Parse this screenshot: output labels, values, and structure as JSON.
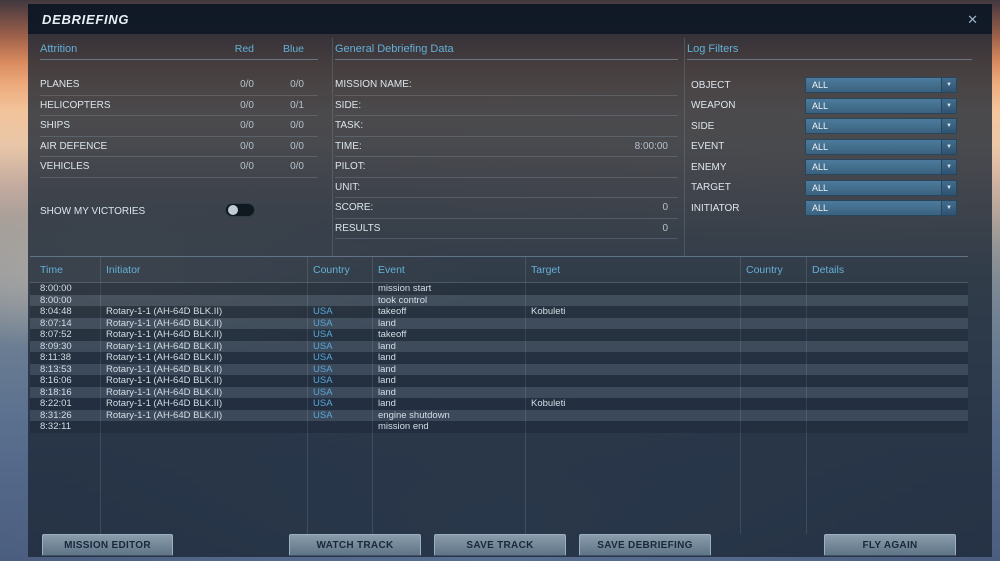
{
  "title_bar": {
    "title": "DEBRIEFING",
    "close": "✕"
  },
  "attrition": {
    "header": "Attrition",
    "col_red": "Red",
    "col_blue": "Blue",
    "rows": [
      {
        "label": "PLANES",
        "red": "0/0",
        "blue": "0/0"
      },
      {
        "label": "HELICOPTERS",
        "red": "0/0",
        "blue": "0/1"
      },
      {
        "label": "SHIPS",
        "red": "0/0",
        "blue": "0/0"
      },
      {
        "label": "AIR DEFENCE",
        "red": "0/0",
        "blue": "0/0"
      },
      {
        "label": "VEHICLES",
        "red": "0/0",
        "blue": "0/0"
      }
    ],
    "show_victories_label": "SHOW MY VICTORIES",
    "show_victories_state": "off"
  },
  "general": {
    "header": "General Debriefing Data",
    "rows": [
      {
        "label": "MISSION NAME:",
        "value": ""
      },
      {
        "label": "SIDE:",
        "value": ""
      },
      {
        "label": "TASK:",
        "value": ""
      },
      {
        "label": "TIME:",
        "value": "8:00:00"
      },
      {
        "label": "PILOT:",
        "value": ""
      },
      {
        "label": "UNIT:",
        "value": ""
      },
      {
        "label": "SCORE:",
        "value": "0"
      },
      {
        "label": "RESULTS",
        "value": "0"
      }
    ]
  },
  "log_filters": {
    "header": "Log Filters",
    "filters": [
      {
        "label": "OBJECT",
        "value": "ALL"
      },
      {
        "label": "WEAPON",
        "value": "ALL"
      },
      {
        "label": "SIDE",
        "value": "ALL"
      },
      {
        "label": "EVENT",
        "value": "ALL"
      },
      {
        "label": "ENEMY",
        "value": "ALL"
      },
      {
        "label": "TARGET",
        "value": "ALL"
      },
      {
        "label": "INITIATOR",
        "value": "ALL"
      }
    ]
  },
  "log_table": {
    "columns": [
      "Time",
      "Initiator",
      "Country",
      "Event",
      "Target",
      "Country",
      "Details"
    ],
    "rows": [
      [
        "8:00:00",
        "",
        "",
        "mission start",
        "",
        "",
        ""
      ],
      [
        "8:00:00",
        "",
        "",
        "took control",
        "",
        "",
        ""
      ],
      [
        "8:04:48",
        "Rotary-1-1 (AH-64D BLK.II)",
        "USA",
        "takeoff",
        "Kobuleti",
        "",
        ""
      ],
      [
        "8:07:14",
        "Rotary-1-1 (AH-64D BLK.II)",
        "USA",
        "land",
        "",
        "",
        ""
      ],
      [
        "8:07:52",
        "Rotary-1-1 (AH-64D BLK.II)",
        "USA",
        "takeoff",
        "",
        "",
        ""
      ],
      [
        "8:09:30",
        "Rotary-1-1 (AH-64D BLK.II)",
        "USA",
        "land",
        "",
        "",
        ""
      ],
      [
        "8:11:38",
        "Rotary-1-1 (AH-64D BLK.II)",
        "USA",
        "land",
        "",
        "",
        ""
      ],
      [
        "8:13:53",
        "Rotary-1-1 (AH-64D BLK.II)",
        "USA",
        "land",
        "",
        "",
        ""
      ],
      [
        "8:16:06",
        "Rotary-1-1 (AH-64D BLK.II)",
        "USA",
        "land",
        "",
        "",
        ""
      ],
      [
        "8:18:16",
        "Rotary-1-1 (AH-64D BLK.II)",
        "USA",
        "land",
        "",
        "",
        ""
      ],
      [
        "8:22:01",
        "Rotary-1-1 (AH-64D BLK.II)",
        "USA",
        "land",
        "Kobuleti",
        "",
        ""
      ],
      [
        "8:31:26",
        "Rotary-1-1 (AH-64D BLK.II)",
        "USA",
        "engine shutdown",
        "",
        "",
        ""
      ],
      [
        "8:32:11",
        "",
        "",
        "mission end",
        "",
        "",
        ""
      ]
    ]
  },
  "buttons": {
    "mission_editor": "MISSION EDITOR",
    "watch_track": "WATCH TRACK",
    "save_track": "SAVE TRACK",
    "save_debriefing": "SAVE DEBRIEFING",
    "fly_again": "FLY AGAIN"
  },
  "colors": {
    "accent_blue": "#63b0d8",
    "usa_country": "#57a7da",
    "panel_bg": "#1b2734",
    "button_text": "#17293b"
  }
}
